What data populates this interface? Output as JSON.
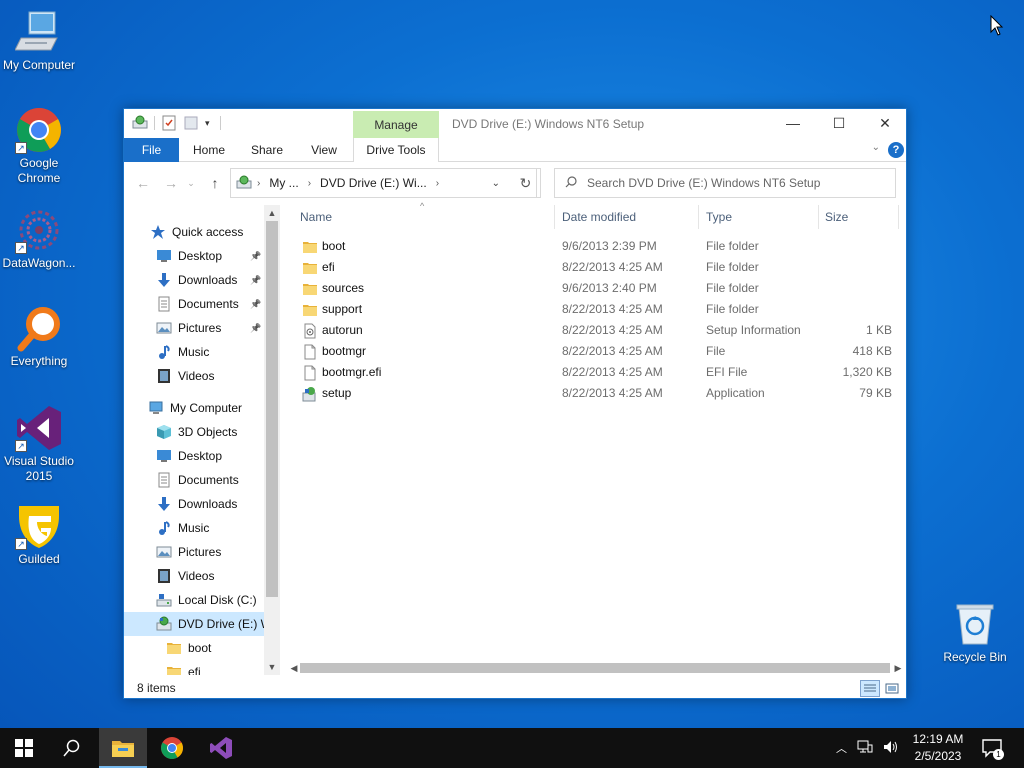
{
  "desktop": {
    "icons": [
      {
        "label": "My Computer",
        "icon": "computer-icon"
      },
      {
        "label": "Google Chrome",
        "icon": "chrome-icon"
      },
      {
        "label": "DataWagon...",
        "icon": "datawagon-icon"
      },
      {
        "label": "Everything",
        "icon": "everything-search-icon"
      },
      {
        "label": "Visual Studio 2015",
        "icon": "visual-studio-icon"
      },
      {
        "label": "Guilded",
        "icon": "guilded-icon"
      }
    ],
    "recycle_bin": {
      "label": "Recycle Bin",
      "icon": "recycle-bin-icon"
    }
  },
  "window": {
    "title": "DVD Drive (E:) Windows NT6 Setup",
    "contextual_tab": "Manage",
    "controls": {
      "minimize": "—",
      "maximize": "☐",
      "close": "✕"
    },
    "ribbon_tabs": [
      "File",
      "Home",
      "Share",
      "View",
      "Drive Tools"
    ],
    "help": "?",
    "address": {
      "segments": [
        "My ...",
        "DVD Drive (E:) Wi..."
      ]
    },
    "search_placeholder": "Search DVD Drive (E:) Windows NT6 Setup",
    "nav": {
      "quick_access": "Quick access",
      "quick_items": [
        {
          "label": "Desktop",
          "icon": "desktop-folder-icon",
          "pinned": true
        },
        {
          "label": "Downloads",
          "icon": "downloads-icon",
          "pinned": true
        },
        {
          "label": "Documents",
          "icon": "documents-icon",
          "pinned": true
        },
        {
          "label": "Pictures",
          "icon": "pictures-icon",
          "pinned": true
        },
        {
          "label": "Music",
          "icon": "music-icon",
          "pinned": false
        },
        {
          "label": "Videos",
          "icon": "videos-icon",
          "pinned": false
        }
      ],
      "my_computer": "My Computer",
      "computer_items": [
        {
          "label": "3D Objects",
          "icon": "3d-objects-icon"
        },
        {
          "label": "Desktop",
          "icon": "desktop-folder-icon"
        },
        {
          "label": "Documents",
          "icon": "documents-icon"
        },
        {
          "label": "Downloads",
          "icon": "downloads-icon"
        },
        {
          "label": "Music",
          "icon": "music-icon"
        },
        {
          "label": "Pictures",
          "icon": "pictures-icon"
        },
        {
          "label": "Videos",
          "icon": "videos-icon"
        },
        {
          "label": "Local Disk (C:)",
          "icon": "local-disk-icon"
        },
        {
          "label": "DVD Drive (E:) W",
          "icon": "dvd-drive-icon",
          "selected": true
        },
        {
          "label": "boot",
          "icon": "folder-icon"
        },
        {
          "label": "efi",
          "icon": "folder-icon"
        }
      ]
    },
    "columns": [
      "Name",
      "Date modified",
      "Type",
      "Size"
    ],
    "files": [
      {
        "name": "boot",
        "date": "9/6/2013 2:39 PM",
        "type": "File folder",
        "size": "",
        "icon": "folder-icon"
      },
      {
        "name": "efi",
        "date": "8/22/2013 4:25 AM",
        "type": "File folder",
        "size": "",
        "icon": "folder-icon"
      },
      {
        "name": "sources",
        "date": "9/6/2013 2:40 PM",
        "type": "File folder",
        "size": "",
        "icon": "folder-icon"
      },
      {
        "name": "support",
        "date": "8/22/2013 4:25 AM",
        "type": "File folder",
        "size": "",
        "icon": "folder-icon"
      },
      {
        "name": "autorun",
        "date": "8/22/2013 4:25 AM",
        "type": "Setup Information",
        "size": "1 KB",
        "icon": "setup-info-file-icon"
      },
      {
        "name": "bootmgr",
        "date": "8/22/2013 4:25 AM",
        "type": "File",
        "size": "418 KB",
        "icon": "file-icon"
      },
      {
        "name": "bootmgr.efi",
        "date": "8/22/2013 4:25 AM",
        "type": "EFI File",
        "size": "1,320 KB",
        "icon": "file-icon"
      },
      {
        "name": "setup",
        "date": "8/22/2013 4:25 AM",
        "type": "Application",
        "size": "79 KB",
        "icon": "setup-app-icon"
      }
    ],
    "status": "8 items"
  },
  "taskbar": {
    "clock_time": "12:19 AM",
    "clock_date": "2/5/2023",
    "notification_count": "1"
  }
}
